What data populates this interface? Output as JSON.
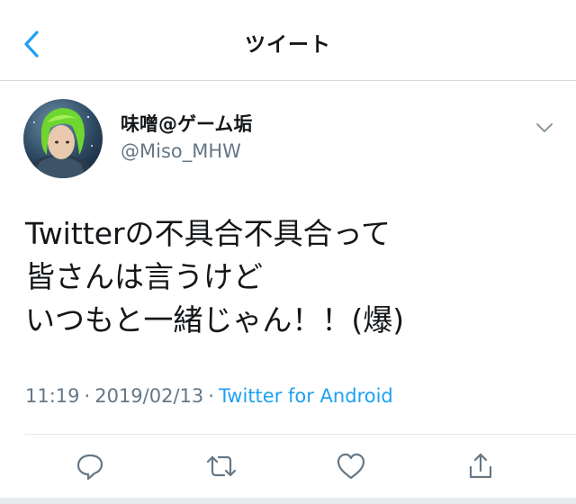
{
  "nav": {
    "title": "ツイート",
    "back_icon": "chevron-left-icon"
  },
  "author": {
    "display_name": "味噌@ゲーム垢",
    "handle": "@Miso_MHW",
    "avatar": "green-haired-character-avatar"
  },
  "tweet": {
    "lines": [
      "Twitterの不具合不具合って",
      "皆さんは言うけど",
      "いつもと一緒じゃん！！(爆)"
    ],
    "time": "11:19",
    "date": "2019/02/13",
    "separator": "·",
    "source": "Twitter for Android"
  },
  "actions": {
    "reply_icon": "speech-bubble-icon",
    "retweet_icon": "retweet-arrows-icon",
    "like_icon": "heart-icon",
    "share_icon": "share-upload-icon"
  },
  "colors": {
    "accent": "#1da1f2",
    "icon_gray": "#657786",
    "text": "#14171a"
  }
}
